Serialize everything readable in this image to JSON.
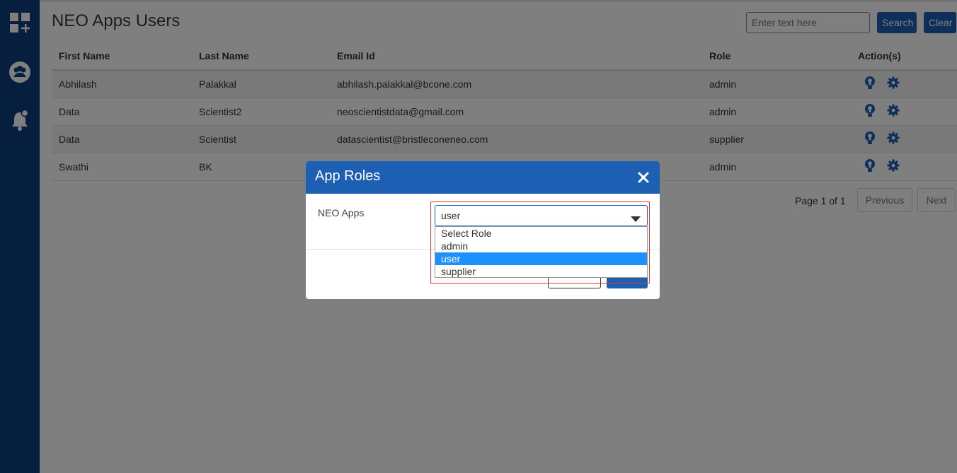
{
  "page": {
    "title": "NEO Apps Users"
  },
  "search": {
    "placeholder": "Enter text here",
    "search_label": "Search",
    "clear_label": "Clear"
  },
  "sidebar": {
    "icons": [
      "grid-add-icon",
      "users-circle-icon",
      "bell-alert-icon"
    ]
  },
  "table": {
    "headers": {
      "first_name": "First Name",
      "last_name": "Last Name",
      "email": "Email Id",
      "role": "Role",
      "actions": "Action(s)"
    },
    "rows": [
      {
        "first_name": "Abhilash",
        "last_name": "Palakkal",
        "email": "abhilash.palakkal@bcone.com",
        "role": "admin"
      },
      {
        "first_name": "Data",
        "last_name": "Scientist2",
        "email": "neoscientistdata@gmail.com",
        "role": "admin"
      },
      {
        "first_name": "Data",
        "last_name": "Scientist",
        "email": "datascientist@bristleconeneo.com",
        "role": "supplier"
      },
      {
        "first_name": "Swathi",
        "last_name": "BK",
        "email": "",
        "role": "admin"
      }
    ]
  },
  "pagination": {
    "text": "Page 1 of 1",
    "previous": "Previous",
    "next": "Next"
  },
  "modal": {
    "title": "App Roles",
    "field_label": "NEO Apps",
    "select_value": "user",
    "options": [
      "Select Role",
      "admin",
      "user",
      "supplier"
    ],
    "selected_option": "user"
  },
  "colors": {
    "sidebar": "#0d3f7f",
    "primary": "#1c5fb3",
    "option_highlight": "#1e90ff",
    "focus_outline": "#e53935"
  }
}
